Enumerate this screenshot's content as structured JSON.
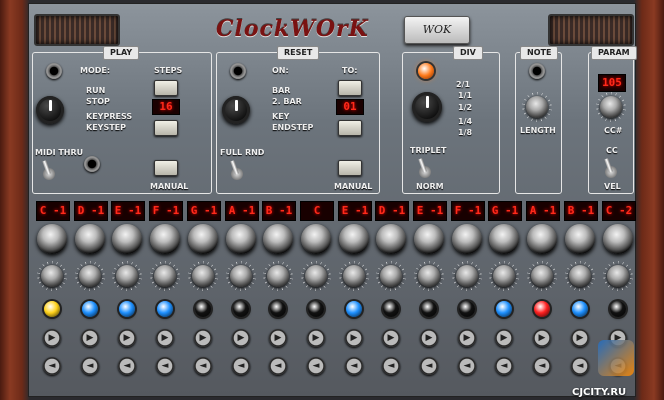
{
  "app": {
    "title": "ClockWOrK",
    "logo": "WOK"
  },
  "sections": {
    "play": {
      "title": "PLAY",
      "mode_label": "MODE:",
      "steps_label": "STEPS",
      "steps_value": "16",
      "modes": [
        "RUN",
        "STOP",
        "KEYPRESS",
        "KEYSTEP"
      ],
      "midi_thru_label": "MIDI THRU",
      "manual_label": "MANUAL"
    },
    "reset": {
      "title": "RESET",
      "on_label": "ON:",
      "to_label": "TO:",
      "to_value": "01",
      "options": [
        "BAR",
        "2. BAR",
        "KEY",
        "ENDSTEP"
      ],
      "full_rnd_label": "FULL RND",
      "manual_label": "MANUAL"
    },
    "div": {
      "title": "DIV",
      "options": [
        "2/1",
        "1/1",
        "1/2",
        "1/4",
        "1/8"
      ],
      "triplet_label": "TRIPLET",
      "norm_label": "NORM"
    },
    "note": {
      "title": "NOTE",
      "length_label": "LENGTH"
    },
    "param": {
      "title": "PARAM",
      "value": "105",
      "cc_hash_label": "CC#",
      "cc_label": "CC",
      "vel_label": "VEL"
    }
  },
  "steps": {
    "notes": [
      "C -1",
      "D -1",
      "E -1",
      "F -1",
      "G -1",
      "A -1",
      "B -1",
      "C",
      "E -1",
      "D -1",
      "E -1",
      "F -1",
      "G -1",
      "A -1",
      "B -1",
      "C -2"
    ],
    "leds": [
      "yellow",
      "blue",
      "blue",
      "blue",
      "off",
      "off",
      "off",
      "off",
      "blue",
      "off",
      "off",
      "off",
      "blue",
      "red",
      "blue",
      "off"
    ]
  },
  "colors": {
    "yellow": "#ffd21a",
    "blue": "#1e90ff",
    "red": "#ff2020",
    "off": "#111111",
    "orange": "#ff7a1a"
  },
  "watermark": {
    "text": "CJCITY.RU"
  }
}
